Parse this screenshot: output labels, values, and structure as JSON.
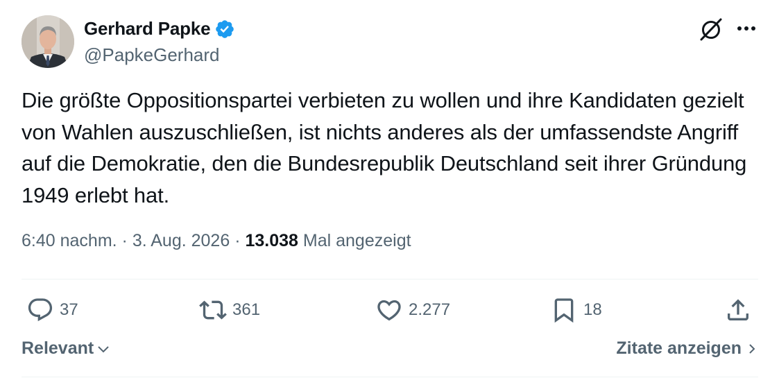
{
  "author": {
    "display_name": "Gerhard Papke",
    "handle": "@PapkeGerhard",
    "verified": true,
    "verified_color": "#1d9bf0"
  },
  "header_icons": [
    "grok-icon",
    "more-options-icon"
  ],
  "tweet": {
    "text": "Die größte Oppositionspartei verbieten zu wollen und ihre Kandidaten gezielt von Wahlen auszuschließen, ist nichts anderes als der umfassendste Angriff auf die Demokratie, den die Bundesrepublik Deutschland seit ihrer Gründung 1949 erlebt hat."
  },
  "meta": {
    "time": "6:40 nachm.",
    "separator": "·",
    "date": "3. Aug. 2026",
    "views_count": "13.038",
    "views_label": "Mal angezeigt"
  },
  "actions": {
    "replies": "37",
    "reposts": "361",
    "likes": "2.277",
    "bookmarks": "18"
  },
  "footer": {
    "sort_label": "Relevant",
    "quotes_label": "Zitate anzeigen"
  },
  "colors": {
    "text_primary": "#0f1419",
    "text_secondary": "#536471",
    "divider": "#eff3f4",
    "accent": "#1d9bf0"
  }
}
